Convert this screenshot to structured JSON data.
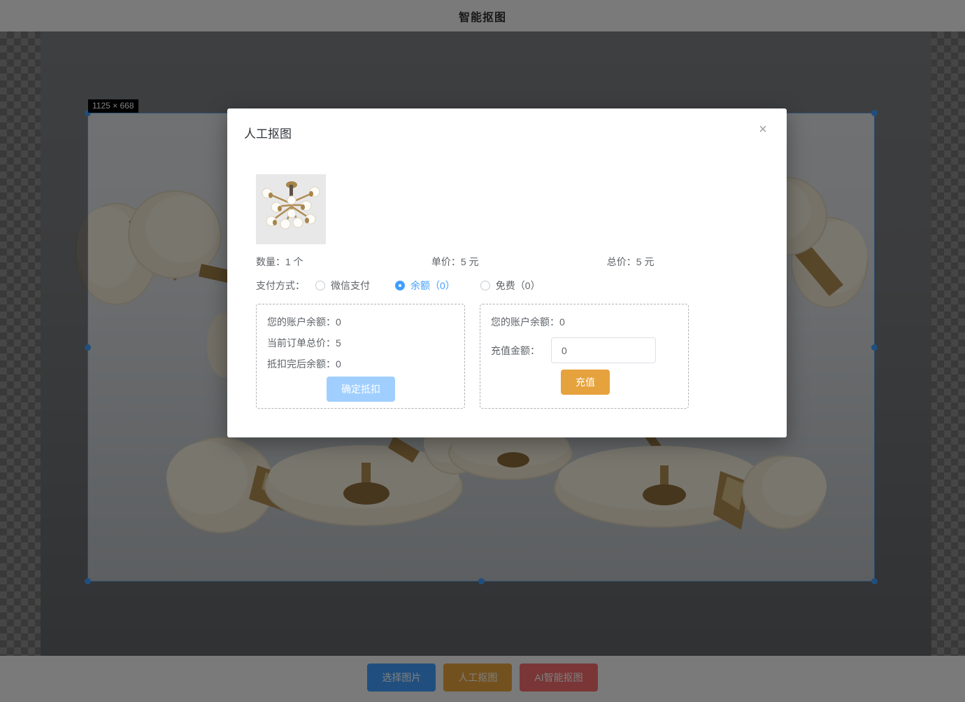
{
  "header": {
    "title": "智能抠图"
  },
  "canvas": {
    "size_label": "1125 × 668"
  },
  "modal": {
    "title": "人工抠图",
    "close_icon": "×",
    "summary": {
      "quantity_label": "数量：",
      "quantity_value": "1 个",
      "unit_price_label": "单价：",
      "unit_price_value": "5 元",
      "total_price_label": "总价：",
      "total_price_value": "5 元"
    },
    "payment": {
      "label": "支付方式：",
      "options": [
        {
          "label": "微信支付",
          "selected": false
        },
        {
          "label": "余额（0）",
          "selected": true
        },
        {
          "label": "免费（0）",
          "selected": false
        }
      ]
    },
    "deduct_box": {
      "account_balance_label": "您的账户余额：",
      "account_balance_value": "0",
      "order_total_label": "当前订单总价：",
      "order_total_value": "5",
      "after_deduct_label": "抵扣完后余额：",
      "after_deduct_value": "0",
      "confirm_button_label": "确定抵扣"
    },
    "recharge_box": {
      "account_balance_label": "您的账户余额：",
      "account_balance_value": "0",
      "amount_label": "充值金额：",
      "amount_value": "0",
      "recharge_button_label": "充值"
    }
  },
  "footer": {
    "buttons": [
      {
        "label": "选择图片",
        "color": "#409EFF"
      },
      {
        "label": "人工抠图",
        "color": "#E6A23C"
      },
      {
        "label": "AI智能抠图",
        "color": "#F56C6C"
      }
    ]
  },
  "colors": {
    "accent_blue": "#409EFF",
    "disabled_blue": "#a0cfff",
    "warning_orange": "#E6A23C",
    "danger_red": "#F56C6C",
    "selection_handle": "#409EFF",
    "overlay": "rgba(0,0,0,0.5)"
  }
}
